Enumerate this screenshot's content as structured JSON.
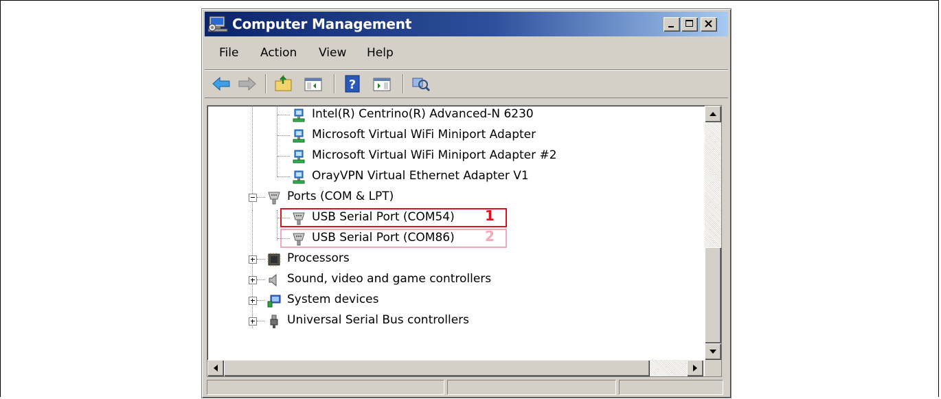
{
  "window": {
    "title": "Computer Management"
  },
  "menu": [
    "File",
    "Action",
    "View",
    "Help"
  ],
  "toolbar": {
    "buttons": [
      "back-arrow-icon",
      "forward-arrow-icon",
      "up-folder-icon",
      "show-hide-console-tree-icon",
      "help-icon",
      "show-hide-action-pane-icon",
      "scan-hardware-changes-icon"
    ]
  },
  "tree": {
    "network_adapters": [
      "Intel(R) Centrino(R) Advanced-N 6230",
      "Microsoft Virtual WiFi Miniport Adapter",
      "Microsoft Virtual WiFi Miniport Adapter #2",
      "OrayVPN Virtual Ethernet Adapter V1"
    ],
    "ports_category": "Ports (COM & LPT)",
    "ports": [
      "USB Serial Port (COM54)",
      "USB Serial Port (COM86)"
    ],
    "annotations": [
      "1",
      "2"
    ],
    "categories": [
      "Processors",
      "Sound, video and game controllers",
      "System devices",
      "Universal Serial Bus controllers"
    ]
  },
  "colors": {
    "title_gradient_start": "#0a246a",
    "annotation_1": "#e0101e",
    "annotation_2": "#f4a9b6"
  },
  "statusbar": [
    "",
    "",
    ""
  ]
}
